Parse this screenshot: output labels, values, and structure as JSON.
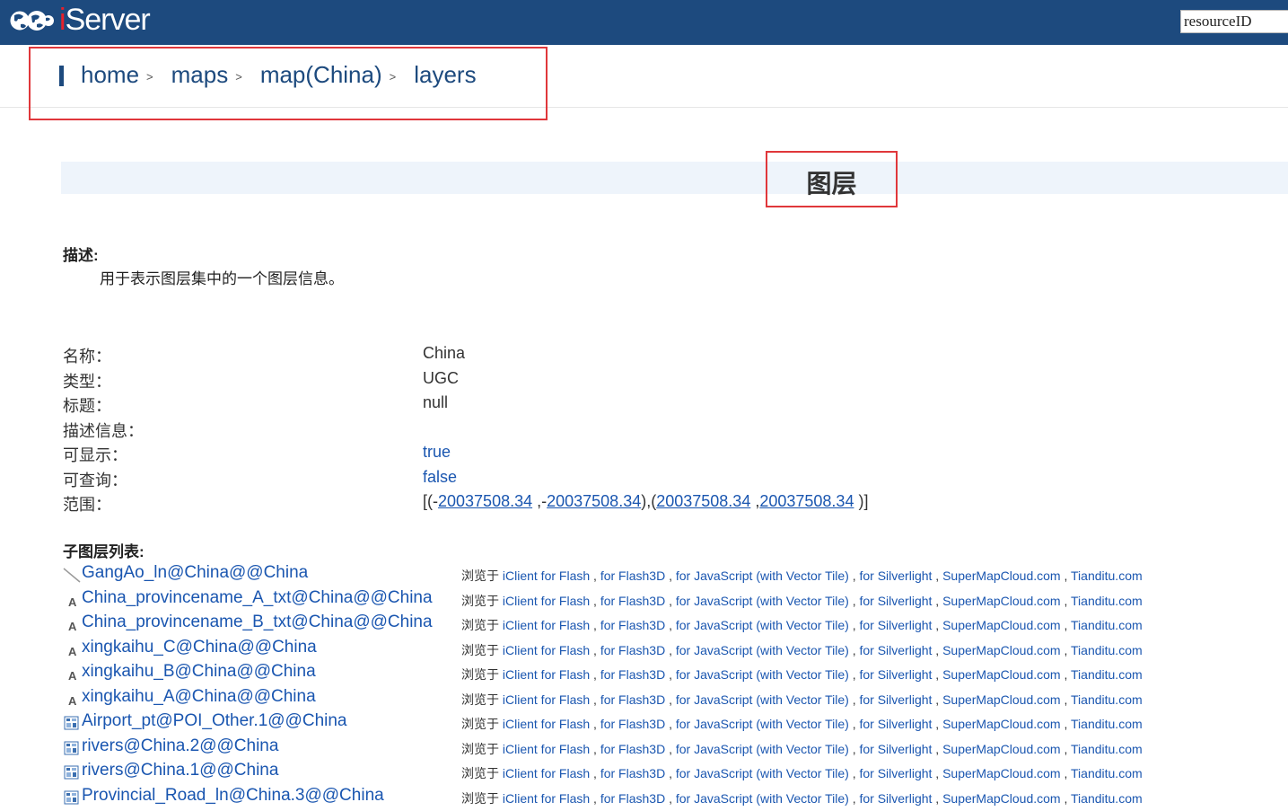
{
  "header": {
    "logo_text": "Server",
    "logo_letter": "i",
    "search": {
      "value": "resourceID"
    }
  },
  "breadcrumb": [
    {
      "label": "home",
      "sep": ">"
    },
    {
      "label": "maps",
      "sep": ">"
    },
    {
      "label": "map(China)",
      "sep": ">"
    },
    {
      "label": "layers",
      "sep": ""
    }
  ],
  "title": "图层",
  "description": {
    "label": "描述:",
    "text": "用于表示图层集中的一个图层信息。"
  },
  "properties": [
    {
      "key": "名称：",
      "value": "China",
      "link": false
    },
    {
      "key": "类型：",
      "value": "UGC",
      "link": false
    },
    {
      "key": "标题：",
      "value": "null",
      "link": false
    },
    {
      "key": "描述信息：",
      "value": "",
      "link": false
    },
    {
      "key": "可显示：",
      "value": "true",
      "link": true
    },
    {
      "key": "可查询：",
      "value": "false",
      "link": true
    }
  ],
  "bounds": {
    "key": "范围：",
    "v1": "20037508.34",
    "v2": "20037508.34",
    "v3": "20037508.34",
    "v4": "20037508.34"
  },
  "sublayers_label": "子图层列表:",
  "browse": {
    "prefix": "浏览于",
    "links": [
      "iClient for Flash",
      "for Flash3D",
      "for JavaScript (with Vector Tile)",
      "for Silverlight",
      "SuperMapCloud.com",
      "Tianditu.com"
    ]
  },
  "sublayers": [
    {
      "name": "GangAo_ln@China@@China",
      "icon": "line-layer-icon"
    },
    {
      "name": "China_provincename_A_txt@China@@China",
      "icon": "text-layer-icon"
    },
    {
      "name": "China_provincename_B_txt@China@@China",
      "icon": "text-layer-icon"
    },
    {
      "name": "xingkaihu_C@China@@China",
      "icon": "text-layer-icon"
    },
    {
      "name": "xingkaihu_B@China@@China",
      "icon": "text-layer-icon"
    },
    {
      "name": "xingkaihu_A@China@@China",
      "icon": "text-layer-icon"
    },
    {
      "name": "Airport_pt@POI_Other.1@@China",
      "icon": "theme-layer-icon"
    },
    {
      "name": "rivers@China.2@@China",
      "icon": "theme-layer-icon"
    },
    {
      "name": "rivers@China.1@@China",
      "icon": "theme-layer-icon"
    },
    {
      "name": "Provincial_Road_ln@China.3@@China",
      "icon": "theme-layer-icon"
    }
  ]
}
